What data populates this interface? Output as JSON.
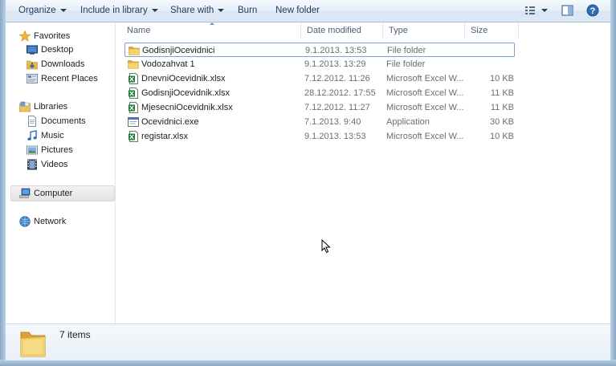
{
  "toolbar": {
    "organize": "Organize",
    "include_in_library": "Include in library",
    "share_with": "Share with",
    "burn": "Burn",
    "new_folder": "New folder"
  },
  "nav": {
    "favorites": "Favorites",
    "desktop": "Desktop",
    "downloads": "Downloads",
    "recent_places": "Recent Places",
    "libraries": "Libraries",
    "documents": "Documents",
    "music": "Music",
    "pictures": "Pictures",
    "videos": "Videos",
    "computer": "Computer",
    "network": "Network"
  },
  "columns": {
    "name": "Name",
    "date_modified": "Date modified",
    "type": "Type",
    "size": "Size"
  },
  "files": [
    {
      "name": "GodisnjiOcevidnici",
      "date": "9.1.2013. 13:53",
      "type": "File folder",
      "size": "",
      "icon": "folder-icon"
    },
    {
      "name": "Vodozahvat 1",
      "date": "9.1.2013. 13:29",
      "type": "File folder",
      "size": "",
      "icon": "folder-icon"
    },
    {
      "name": "DnevniOcevidnik.xlsx",
      "date": "7.12.2012. 11:26",
      "type": "Microsoft Excel W...",
      "size": "10 KB",
      "icon": "excel-file-icon"
    },
    {
      "name": "GodisnjiOcevidnik.xlsx",
      "date": "28.12.2012. 17:55",
      "type": "Microsoft Excel W...",
      "size": "11 KB",
      "icon": "excel-file-icon"
    },
    {
      "name": "MjesecniOcevidnik.xlsx",
      "date": "7.12.2012. 11:27",
      "type": "Microsoft Excel W...",
      "size": "11 KB",
      "icon": "excel-file-icon"
    },
    {
      "name": "Ocevidnici.exe",
      "date": "7.1.2013. 9:40",
      "type": "Application",
      "size": "30 KB",
      "icon": "application-icon"
    },
    {
      "name": "registar.xlsx",
      "date": "9.1.2013. 13:53",
      "type": "Microsoft Excel W...",
      "size": "10 KB",
      "icon": "excel-file-icon"
    }
  ],
  "status": {
    "item_count": "7 items"
  }
}
